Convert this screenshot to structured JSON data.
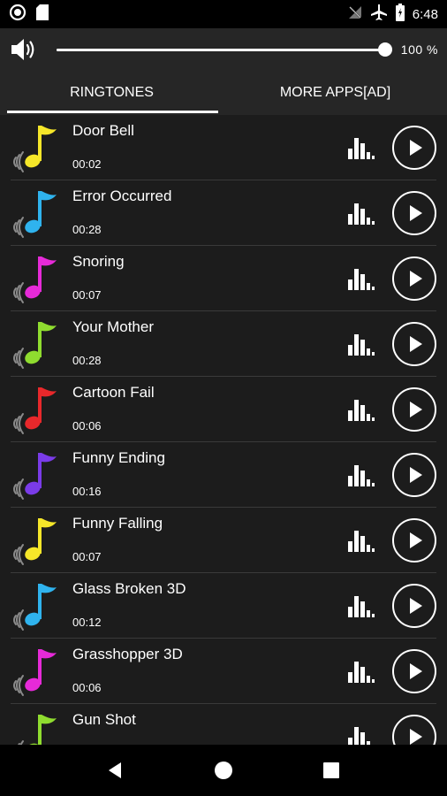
{
  "status_bar": {
    "time": "6:48",
    "icons": [
      "record-icon",
      "sd-card-icon",
      "no-signal-icon",
      "airplane-icon",
      "battery-icon"
    ]
  },
  "volume": {
    "percent_label": "100 %",
    "level": 1.0
  },
  "tabs": [
    {
      "label": "RINGTONES",
      "selected": true
    },
    {
      "label": "MORE APPS[AD]",
      "selected": false
    }
  ],
  "ringtones": [
    {
      "title": "Door Bell",
      "duration": "00:02",
      "color": "#f5e629"
    },
    {
      "title": "Error Occurred",
      "duration": "00:28",
      "color": "#2fb3ee"
    },
    {
      "title": "Snoring",
      "duration": "00:07",
      "color": "#e62ad8"
    },
    {
      "title": "Your Mother",
      "duration": "00:28",
      "color": "#8fdc2f"
    },
    {
      "title": "Cartoon Fail",
      "duration": "00:06",
      "color": "#e8282b"
    },
    {
      "title": "Funny Ending",
      "duration": "00:16",
      "color": "#7a3be8"
    },
    {
      "title": "Funny Falling",
      "duration": "00:07",
      "color": "#f5e629"
    },
    {
      "title": "Glass Broken 3D",
      "duration": "00:12",
      "color": "#2fb3ee"
    },
    {
      "title": "Grasshopper 3D",
      "duration": "00:06",
      "color": "#e62ad8"
    },
    {
      "title": "Gun Shot",
      "duration": "",
      "color": "#8fdc2f"
    }
  ],
  "nav_bar": {
    "icons": [
      "back-icon",
      "home-icon",
      "recents-icon"
    ]
  }
}
